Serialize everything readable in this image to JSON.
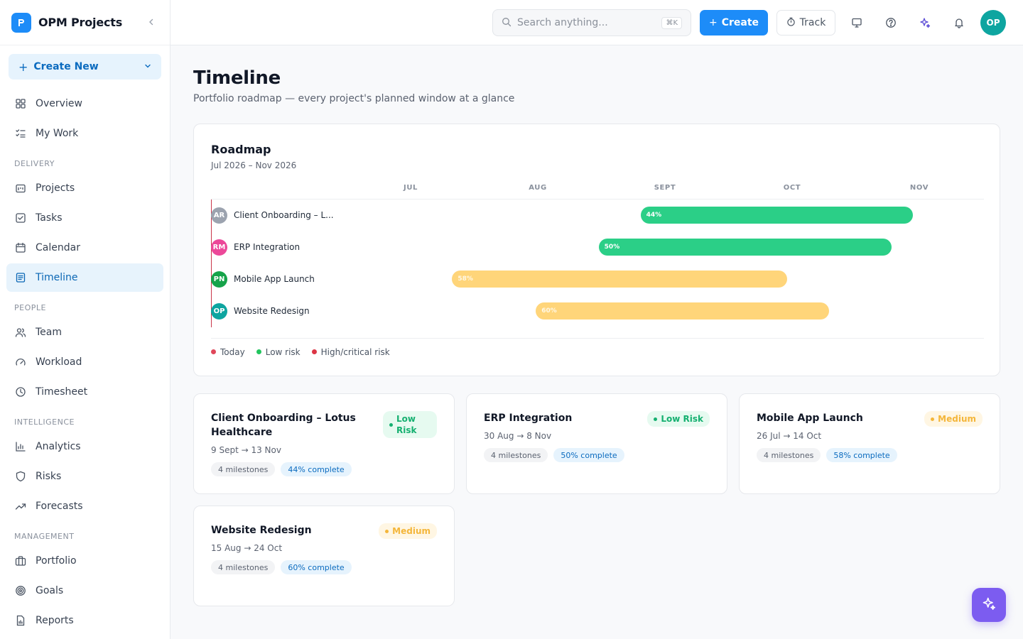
{
  "app": {
    "name": "OPM Projects"
  },
  "sidebar": {
    "create_new": "Create New",
    "top_items": [
      {
        "label": "Overview"
      },
      {
        "label": "My Work"
      }
    ],
    "sections": [
      {
        "title": "DELIVERY",
        "items": [
          {
            "label": "Projects"
          },
          {
            "label": "Tasks"
          },
          {
            "label": "Calendar"
          },
          {
            "label": "Timeline"
          }
        ]
      },
      {
        "title": "PEOPLE",
        "items": [
          {
            "label": "Team"
          },
          {
            "label": "Workload"
          },
          {
            "label": "Timesheet"
          }
        ]
      },
      {
        "title": "INTELLIGENCE",
        "items": [
          {
            "label": "Analytics"
          },
          {
            "label": "Risks"
          },
          {
            "label": "Forecasts"
          }
        ]
      },
      {
        "title": "MANAGEMENT",
        "items": [
          {
            "label": "Portfolio"
          },
          {
            "label": "Goals"
          },
          {
            "label": "Reports"
          }
        ]
      }
    ],
    "active": "Timeline"
  },
  "header": {
    "search_placeholder": "Search anything...",
    "search_shortcut": "⌘K",
    "create_label": "Create",
    "track_label": "Track",
    "user_initials": "OP"
  },
  "page": {
    "title": "Timeline",
    "subtitle": "Portfolio roadmap — every project's planned window at a glance"
  },
  "roadmap": {
    "title": "Roadmap",
    "range": "Jul 2026 – Nov 2026",
    "months": [
      "JUL",
      "AUG",
      "SEPT",
      "OCT",
      "NOV"
    ],
    "rows": [
      {
        "initials": "AR",
        "label": "Client Onboarding – Lotus Healthcare",
        "display_label": "Client Onboarding – L...",
        "avatar_color": "#9ca3af",
        "progress_label": "44%",
        "risk": "low",
        "start": "2026-09-09",
        "end": "2026-11-13"
      },
      {
        "initials": "RM",
        "label": "ERP Integration",
        "display_label": "ERP Integration",
        "avatar_color": "#ec4899",
        "progress_label": "50%",
        "risk": "low",
        "start": "2026-08-30",
        "end": "2026-11-08"
      },
      {
        "initials": "PN",
        "label": "Mobile App Launch",
        "display_label": "Mobile App Launch",
        "avatar_color": "#16a34a",
        "progress_label": "58%",
        "risk": "med",
        "start": "2026-07-26",
        "end": "2026-10-14"
      },
      {
        "initials": "OP",
        "label": "Website Redesign",
        "display_label": "Website Redesign",
        "avatar_color": "#0ea5a0",
        "progress_label": "60%",
        "risk": "med",
        "start": "2026-08-15",
        "end": "2026-10-24"
      }
    ],
    "legend": [
      {
        "label": "Today",
        "color": "#e0475a"
      },
      {
        "label": "Low risk",
        "color": "#22c55e"
      },
      {
        "label": "High/critical risk",
        "color": "#dc3545"
      }
    ]
  },
  "projects": [
    {
      "title": "Client Onboarding – Lotus Healthcare",
      "risk_label": "Low Risk",
      "risk": "low",
      "dates": "9 Sept → 13 Nov",
      "milestones": "4 milestones",
      "complete": "44% complete"
    },
    {
      "title": "ERP Integration",
      "risk_label": "Low Risk",
      "risk": "low",
      "dates": "30 Aug → 8 Nov",
      "milestones": "4 milestones",
      "complete": "50% complete"
    },
    {
      "title": "Mobile App Launch",
      "risk_label": "Medium",
      "risk": "med",
      "dates": "26 Jul → 14 Oct",
      "milestones": "4 milestones",
      "complete": "58% complete"
    },
    {
      "title": "Website Redesign",
      "risk_label": "Medium",
      "risk": "med",
      "dates": "15 Aug → 24 Oct",
      "milestones": "4 milestones",
      "complete": "60% complete"
    }
  ]
}
